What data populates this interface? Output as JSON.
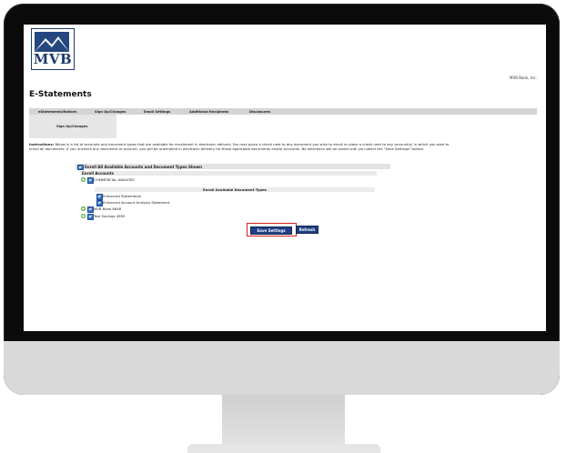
{
  "bank": {
    "logo_text": "MVB",
    "name": "MVB Bank, Inc."
  },
  "page": {
    "title": "E-Statements"
  },
  "tabs": [
    {
      "label": "eStatements/Notices"
    },
    {
      "label": "Sign Up/Changes"
    },
    {
      "label": "Email Settings"
    },
    {
      "label": "Additional Recipients"
    },
    {
      "label": "Disclosures"
    }
  ],
  "subtab": {
    "label": "Sign Up/Changes"
  },
  "instructions": {
    "heading": "Instructions:",
    "line1": "Below is a list of accounts and document types that are available for enrollment in electronic delivery. You may place a check next to any document you wish to enroll or place a check next to any account(s) in which you wish to",
    "line2": "enroll all documents. If you uncheck any document or account, you will be unenrolled in electronic delivery for those applicable documents and/or accounts. No selections will be saved until you select the \"Save Settings\" button."
  },
  "enroll_all": {
    "label": "Enroll All Available Accounts and Document Types Shown",
    "checked": true
  },
  "enroll_accounts": {
    "heading": "Enroll Accounts"
  },
  "accounts": [
    {
      "name": "COMMERCIAL ANALYSIS",
      "checked": true,
      "expanded": true
    },
    {
      "name": "MVB Bank 6848",
      "checked": true,
      "expanded": false
    },
    {
      "name": "Test Savings 4995",
      "checked": true,
      "expanded": false
    }
  ],
  "doc_types": {
    "heading": "Enroll Available Document Types",
    "items": [
      {
        "name": "Enhanced Statements",
        "checked": true
      },
      {
        "name": "Enhanced Account Analysis Statement",
        "checked": true
      }
    ]
  },
  "buttons": {
    "save": "Save Settings",
    "refresh": "Refresh"
  },
  "colors": {
    "button_bg": "#1f3f86",
    "highlight_border": "#d62020",
    "checkbox": "#3a74c9",
    "expand_icon": "#5cae3f",
    "logo_blue": "#24477f"
  }
}
